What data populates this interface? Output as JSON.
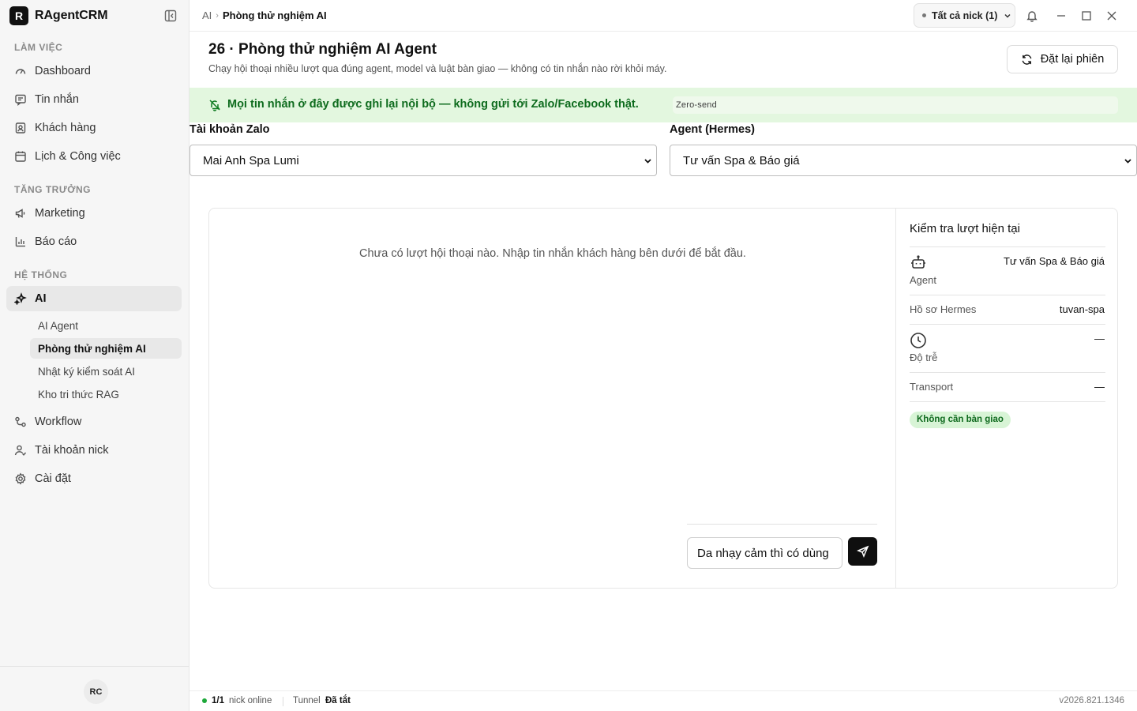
{
  "app": {
    "logo_letter": "R",
    "name": "RAgentCRM"
  },
  "sidebar": {
    "sections": [
      {
        "title": "LÀM VIỆC"
      },
      {
        "title": "TĂNG TRƯỞNG"
      },
      {
        "title": "HỆ THỐNG"
      }
    ],
    "items": {
      "dashboard": "Dashboard",
      "messages": "Tin nhắn",
      "customers": "Khách hàng",
      "calendar": "Lịch & Công việc",
      "marketing": "Marketing",
      "reports": "Báo cáo",
      "ai": "AI",
      "workflow": "Workflow",
      "accounts": "Tài khoản nick",
      "settings": "Cài đặt"
    },
    "ai_sub": {
      "agent": "AI Agent",
      "lab": "Phòng thử nghiệm AI",
      "audit": "Nhật ký kiểm soát AI",
      "rag": "Kho tri thức RAG"
    },
    "avatar": "RC"
  },
  "topbar": {
    "breadcrumb": {
      "parent": "AI",
      "current": "Phòng thử nghiệm AI"
    },
    "nick_filter": "Tất cả nick (1)"
  },
  "page": {
    "title": "26 · Phòng thử nghiệm AI Agent",
    "subtitle": "Chạy hội thoại nhiều lượt qua đúng agent, model và luật bàn giao — không có tin nhắn nào rời khỏi máy.",
    "reset_label": "Đặt lại phiên"
  },
  "notice": {
    "text": "Mọi tin nhắn ở đây được ghi lại nội bộ — không gửi tới Zalo/Facebook thật.",
    "badge": "Zero-send"
  },
  "form": {
    "zalo_label": "Tài khoản Zalo",
    "zalo_value": "Mai Anh Spa Lumi",
    "agent_label": "Agent (Hermes)",
    "agent_value": "Tư vấn Spa & Báo giá"
  },
  "chat": {
    "empty": "Chưa có lượt hội thoại nào. Nhập tin nhắn khách hàng bên dưới để bắt đầu.",
    "input_value": "Da nhạy cảm thì có dùng"
  },
  "inspect": {
    "title": "Kiểm tra lượt hiện tại",
    "agent_label": "Agent",
    "agent_value": "Tư vấn Spa & Báo giá",
    "profile_label": "Hồ sơ Hermes",
    "profile_value": "tuvan-spa",
    "latency_label": "Độ trễ",
    "latency_value": "—",
    "transport_label": "Transport",
    "transport_value": "—",
    "handoff": "Không cần bàn giao"
  },
  "status": {
    "online_count": "1/1",
    "online_label": "nick online",
    "tunnel_label": "Tunnel",
    "tunnel_value": "Đã tắt",
    "version": "v2026.821.1346"
  },
  "colors": {
    "accent_dark": "#0f0f0f",
    "notice_bg": "#e3f7df",
    "notice_text": "#0d6b1d",
    "online": "#1ea83a"
  }
}
